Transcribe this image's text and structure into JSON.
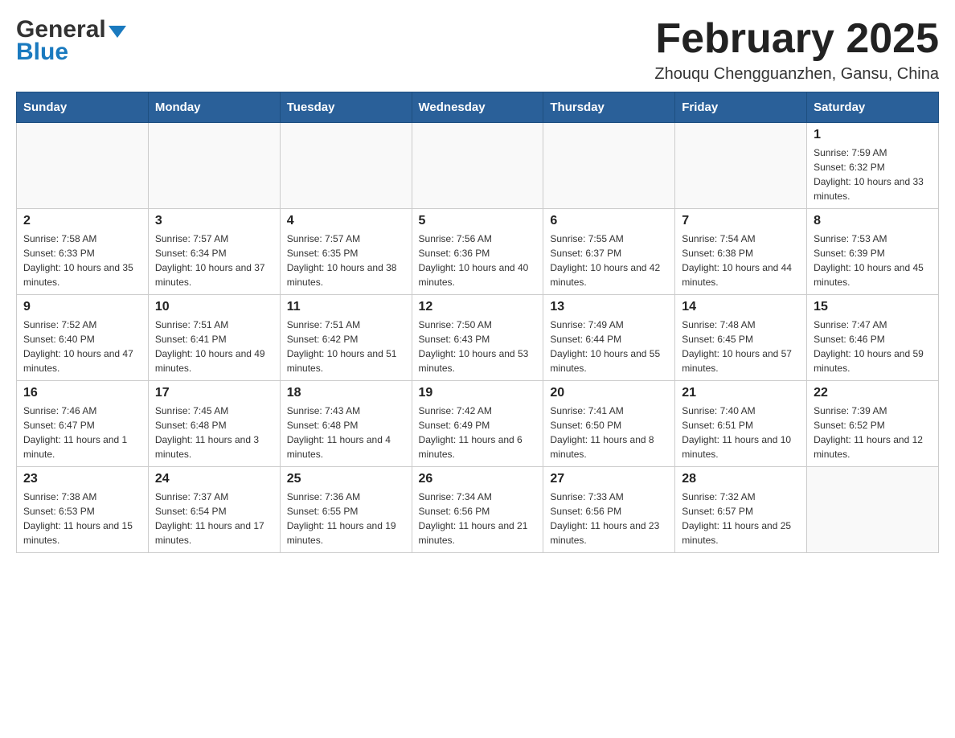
{
  "header": {
    "logo_general": "General",
    "logo_blue": "Blue",
    "title": "February 2025",
    "location": "Zhouqu Chengguanzhen, Gansu, China"
  },
  "days_of_week": [
    "Sunday",
    "Monday",
    "Tuesday",
    "Wednesday",
    "Thursday",
    "Friday",
    "Saturday"
  ],
  "weeks": [
    [
      {
        "day": "",
        "info": ""
      },
      {
        "day": "",
        "info": ""
      },
      {
        "day": "",
        "info": ""
      },
      {
        "day": "",
        "info": ""
      },
      {
        "day": "",
        "info": ""
      },
      {
        "day": "",
        "info": ""
      },
      {
        "day": "1",
        "info": "Sunrise: 7:59 AM\nSunset: 6:32 PM\nDaylight: 10 hours and 33 minutes."
      }
    ],
    [
      {
        "day": "2",
        "info": "Sunrise: 7:58 AM\nSunset: 6:33 PM\nDaylight: 10 hours and 35 minutes."
      },
      {
        "day": "3",
        "info": "Sunrise: 7:57 AM\nSunset: 6:34 PM\nDaylight: 10 hours and 37 minutes."
      },
      {
        "day": "4",
        "info": "Sunrise: 7:57 AM\nSunset: 6:35 PM\nDaylight: 10 hours and 38 minutes."
      },
      {
        "day": "5",
        "info": "Sunrise: 7:56 AM\nSunset: 6:36 PM\nDaylight: 10 hours and 40 minutes."
      },
      {
        "day": "6",
        "info": "Sunrise: 7:55 AM\nSunset: 6:37 PM\nDaylight: 10 hours and 42 minutes."
      },
      {
        "day": "7",
        "info": "Sunrise: 7:54 AM\nSunset: 6:38 PM\nDaylight: 10 hours and 44 minutes."
      },
      {
        "day": "8",
        "info": "Sunrise: 7:53 AM\nSunset: 6:39 PM\nDaylight: 10 hours and 45 minutes."
      }
    ],
    [
      {
        "day": "9",
        "info": "Sunrise: 7:52 AM\nSunset: 6:40 PM\nDaylight: 10 hours and 47 minutes."
      },
      {
        "day": "10",
        "info": "Sunrise: 7:51 AM\nSunset: 6:41 PM\nDaylight: 10 hours and 49 minutes."
      },
      {
        "day": "11",
        "info": "Sunrise: 7:51 AM\nSunset: 6:42 PM\nDaylight: 10 hours and 51 minutes."
      },
      {
        "day": "12",
        "info": "Sunrise: 7:50 AM\nSunset: 6:43 PM\nDaylight: 10 hours and 53 minutes."
      },
      {
        "day": "13",
        "info": "Sunrise: 7:49 AM\nSunset: 6:44 PM\nDaylight: 10 hours and 55 minutes."
      },
      {
        "day": "14",
        "info": "Sunrise: 7:48 AM\nSunset: 6:45 PM\nDaylight: 10 hours and 57 minutes."
      },
      {
        "day": "15",
        "info": "Sunrise: 7:47 AM\nSunset: 6:46 PM\nDaylight: 10 hours and 59 minutes."
      }
    ],
    [
      {
        "day": "16",
        "info": "Sunrise: 7:46 AM\nSunset: 6:47 PM\nDaylight: 11 hours and 1 minute."
      },
      {
        "day": "17",
        "info": "Sunrise: 7:45 AM\nSunset: 6:48 PM\nDaylight: 11 hours and 3 minutes."
      },
      {
        "day": "18",
        "info": "Sunrise: 7:43 AM\nSunset: 6:48 PM\nDaylight: 11 hours and 4 minutes."
      },
      {
        "day": "19",
        "info": "Sunrise: 7:42 AM\nSunset: 6:49 PM\nDaylight: 11 hours and 6 minutes."
      },
      {
        "day": "20",
        "info": "Sunrise: 7:41 AM\nSunset: 6:50 PM\nDaylight: 11 hours and 8 minutes."
      },
      {
        "day": "21",
        "info": "Sunrise: 7:40 AM\nSunset: 6:51 PM\nDaylight: 11 hours and 10 minutes."
      },
      {
        "day": "22",
        "info": "Sunrise: 7:39 AM\nSunset: 6:52 PM\nDaylight: 11 hours and 12 minutes."
      }
    ],
    [
      {
        "day": "23",
        "info": "Sunrise: 7:38 AM\nSunset: 6:53 PM\nDaylight: 11 hours and 15 minutes."
      },
      {
        "day": "24",
        "info": "Sunrise: 7:37 AM\nSunset: 6:54 PM\nDaylight: 11 hours and 17 minutes."
      },
      {
        "day": "25",
        "info": "Sunrise: 7:36 AM\nSunset: 6:55 PM\nDaylight: 11 hours and 19 minutes."
      },
      {
        "day": "26",
        "info": "Sunrise: 7:34 AM\nSunset: 6:56 PM\nDaylight: 11 hours and 21 minutes."
      },
      {
        "day": "27",
        "info": "Sunrise: 7:33 AM\nSunset: 6:56 PM\nDaylight: 11 hours and 23 minutes."
      },
      {
        "day": "28",
        "info": "Sunrise: 7:32 AM\nSunset: 6:57 PM\nDaylight: 11 hours and 25 minutes."
      },
      {
        "day": "",
        "info": ""
      }
    ]
  ]
}
